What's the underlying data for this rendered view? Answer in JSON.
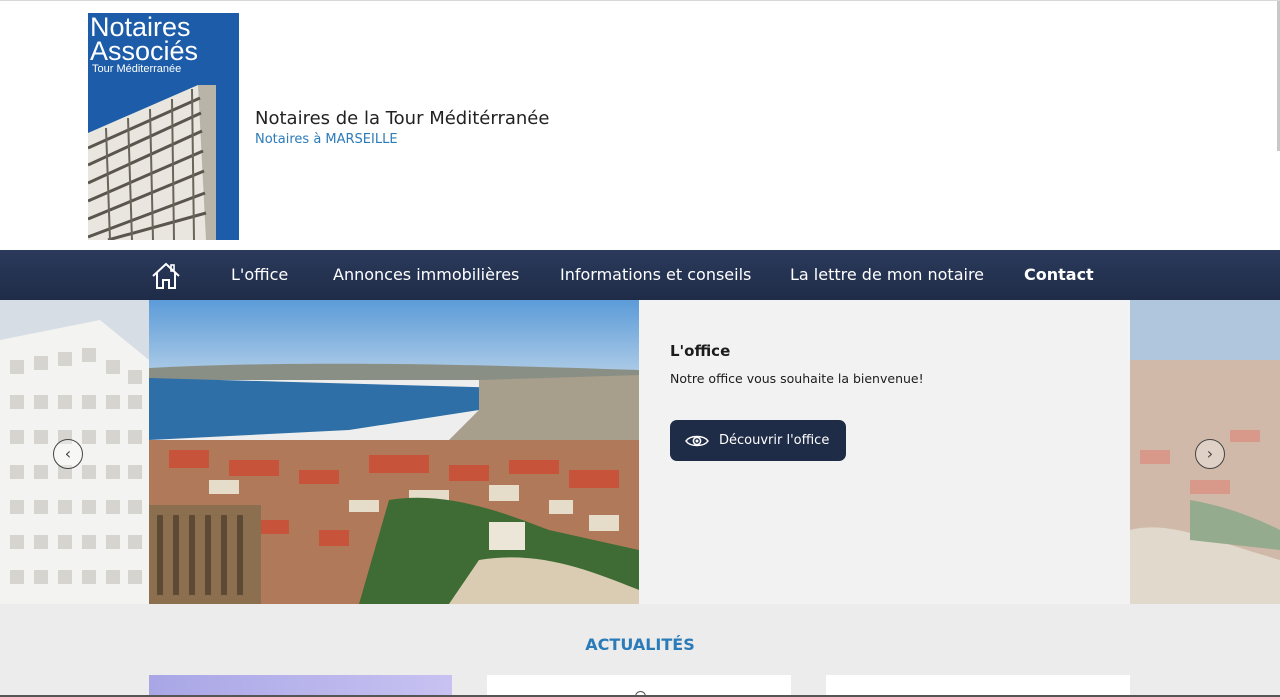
{
  "header": {
    "logo": {
      "line1": "Notaires",
      "line2": "Associés",
      "line3": "Tour Méditerranée"
    },
    "title": "Notaires de la Tour Méditérranée",
    "subtitle": "Notaires à MARSEILLE"
  },
  "nav": {
    "home_icon": "home-icon",
    "items": [
      {
        "label": "L'office"
      },
      {
        "label": "Annonces immobilières"
      },
      {
        "label": "Informations et conseils"
      },
      {
        "label": "La lettre de mon notaire"
      },
      {
        "label": "Contact"
      }
    ]
  },
  "hero": {
    "panel_title": "L'office",
    "panel_text": "Notre office vous souhaite la bienvenue!",
    "button_label": "Découvrir l'office",
    "button_icon": "eye-icon",
    "prev_icon": "chevron-left-icon",
    "next_icon": "chevron-right-icon"
  },
  "news": {
    "title": "ACTUALITÉS"
  },
  "colors": {
    "nav_bg": "#1f2c48",
    "accent_blue": "#2b7bb9",
    "logo_blue": "#1d5ca8"
  }
}
